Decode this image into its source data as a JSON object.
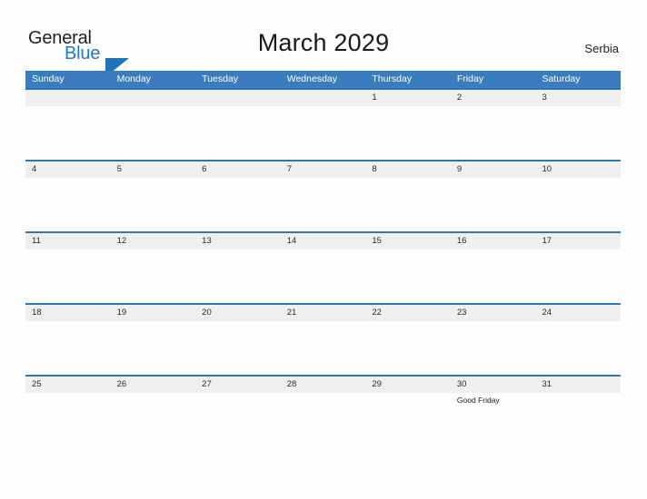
{
  "brand": {
    "word_one": "General",
    "word_two": "Blue",
    "triangle_icon": "triangle-icon",
    "accent_color": "#1f73b8",
    "text_color": "#231f20",
    "blue_text_color": "#1a7ac4"
  },
  "header": {
    "title": "March 2029",
    "country": "Serbia"
  },
  "theme": {
    "header_blue": "#3a7cbe",
    "row_border_blue": "#2f76b9",
    "band_gray": "#efefef",
    "page_background": "#fdfdfd"
  },
  "calendar": {
    "weekdays": [
      "Sunday",
      "Monday",
      "Tuesday",
      "Wednesday",
      "Thursday",
      "Friday",
      "Saturday"
    ],
    "weeks": [
      {
        "days": [
          {
            "date": "",
            "event": ""
          },
          {
            "date": "",
            "event": ""
          },
          {
            "date": "",
            "event": ""
          },
          {
            "date": "",
            "event": ""
          },
          {
            "date": "1",
            "event": ""
          },
          {
            "date": "2",
            "event": ""
          },
          {
            "date": "3",
            "event": ""
          }
        ]
      },
      {
        "days": [
          {
            "date": "4",
            "event": ""
          },
          {
            "date": "5",
            "event": ""
          },
          {
            "date": "6",
            "event": ""
          },
          {
            "date": "7",
            "event": ""
          },
          {
            "date": "8",
            "event": ""
          },
          {
            "date": "9",
            "event": ""
          },
          {
            "date": "10",
            "event": ""
          }
        ]
      },
      {
        "days": [
          {
            "date": "11",
            "event": ""
          },
          {
            "date": "12",
            "event": ""
          },
          {
            "date": "13",
            "event": ""
          },
          {
            "date": "14",
            "event": ""
          },
          {
            "date": "15",
            "event": ""
          },
          {
            "date": "16",
            "event": ""
          },
          {
            "date": "17",
            "event": ""
          }
        ]
      },
      {
        "days": [
          {
            "date": "18",
            "event": ""
          },
          {
            "date": "19",
            "event": ""
          },
          {
            "date": "20",
            "event": ""
          },
          {
            "date": "21",
            "event": ""
          },
          {
            "date": "22",
            "event": ""
          },
          {
            "date": "23",
            "event": ""
          },
          {
            "date": "24",
            "event": ""
          }
        ]
      },
      {
        "days": [
          {
            "date": "25",
            "event": ""
          },
          {
            "date": "26",
            "event": ""
          },
          {
            "date": "27",
            "event": ""
          },
          {
            "date": "28",
            "event": ""
          },
          {
            "date": "29",
            "event": ""
          },
          {
            "date": "30",
            "event": "Good Friday"
          },
          {
            "date": "31",
            "event": ""
          }
        ]
      }
    ]
  }
}
